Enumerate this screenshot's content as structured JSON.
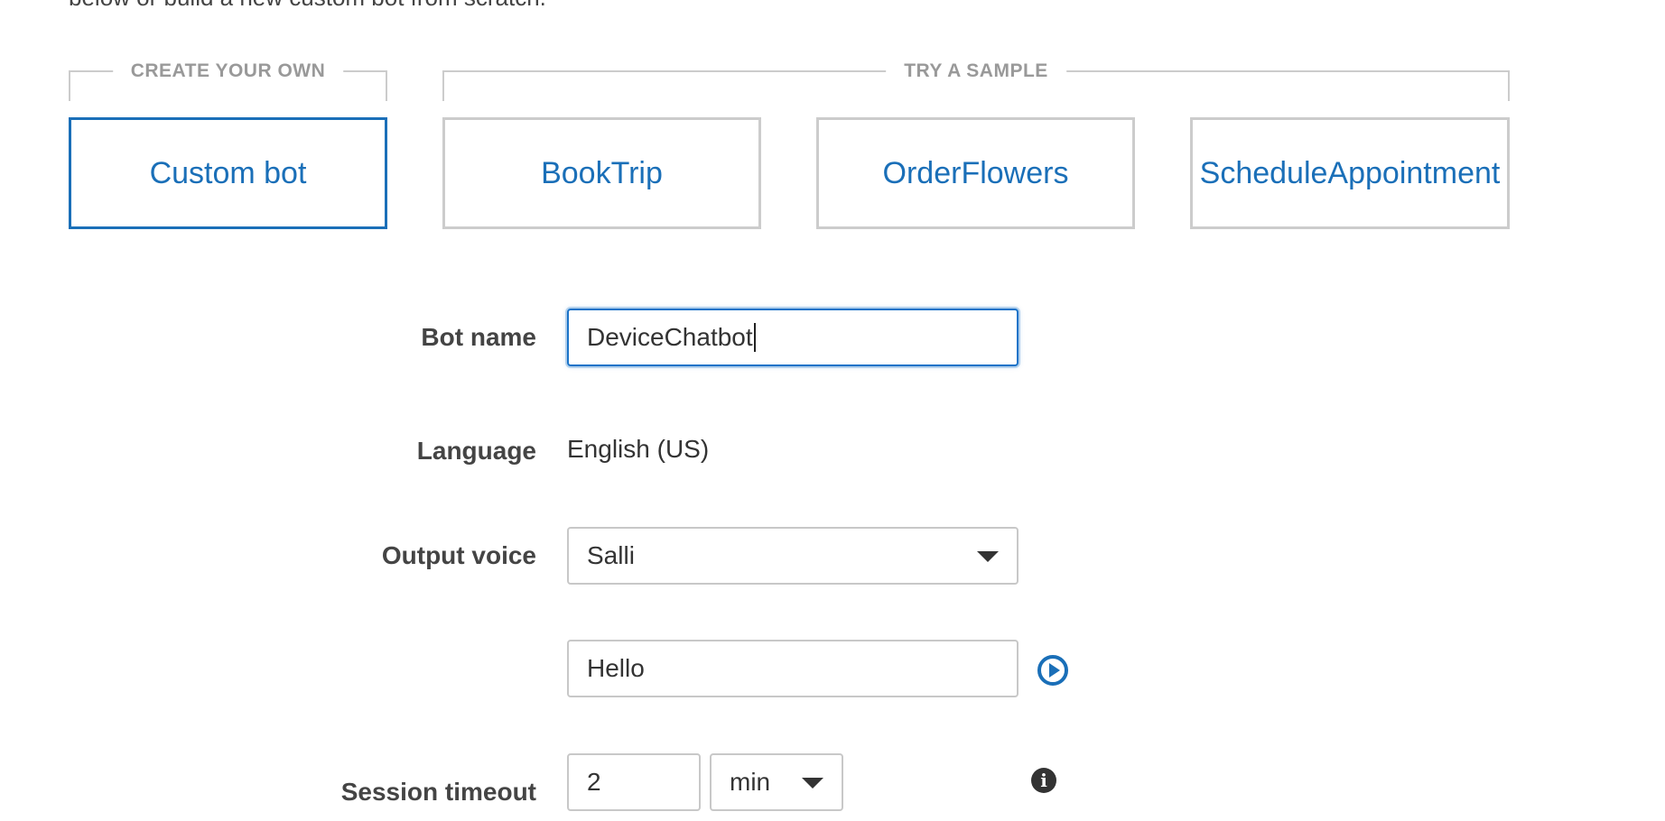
{
  "intro_text": "below or build a new custom bot from scratch.",
  "groups": {
    "create_own_label": "CREATE YOUR OWN",
    "try_sample_label": "TRY A SAMPLE"
  },
  "tiles": [
    {
      "label": "Custom bot",
      "selected": true
    },
    {
      "label": "BookTrip",
      "selected": false
    },
    {
      "label": "OrderFlowers",
      "selected": false
    },
    {
      "label": "ScheduleAppointment",
      "selected": false
    }
  ],
  "form": {
    "bot_name": {
      "label": "Bot name",
      "value": "DeviceChatbot"
    },
    "language": {
      "label": "Language",
      "value": "English (US)"
    },
    "output_voice": {
      "label": "Output voice",
      "value": "Salli"
    },
    "voice_sample": {
      "value": "Hello"
    },
    "session_timeout": {
      "label": "Session timeout",
      "value": "2",
      "unit": "min"
    }
  },
  "icons": {
    "play": "play-circle-icon",
    "info": "info-icon",
    "dropdown": "chevron-down-icon"
  },
  "colors": {
    "accent": "#1a6fb8",
    "border": "#cccccc",
    "label_text": "#444444",
    "caption_text": "#999999"
  }
}
